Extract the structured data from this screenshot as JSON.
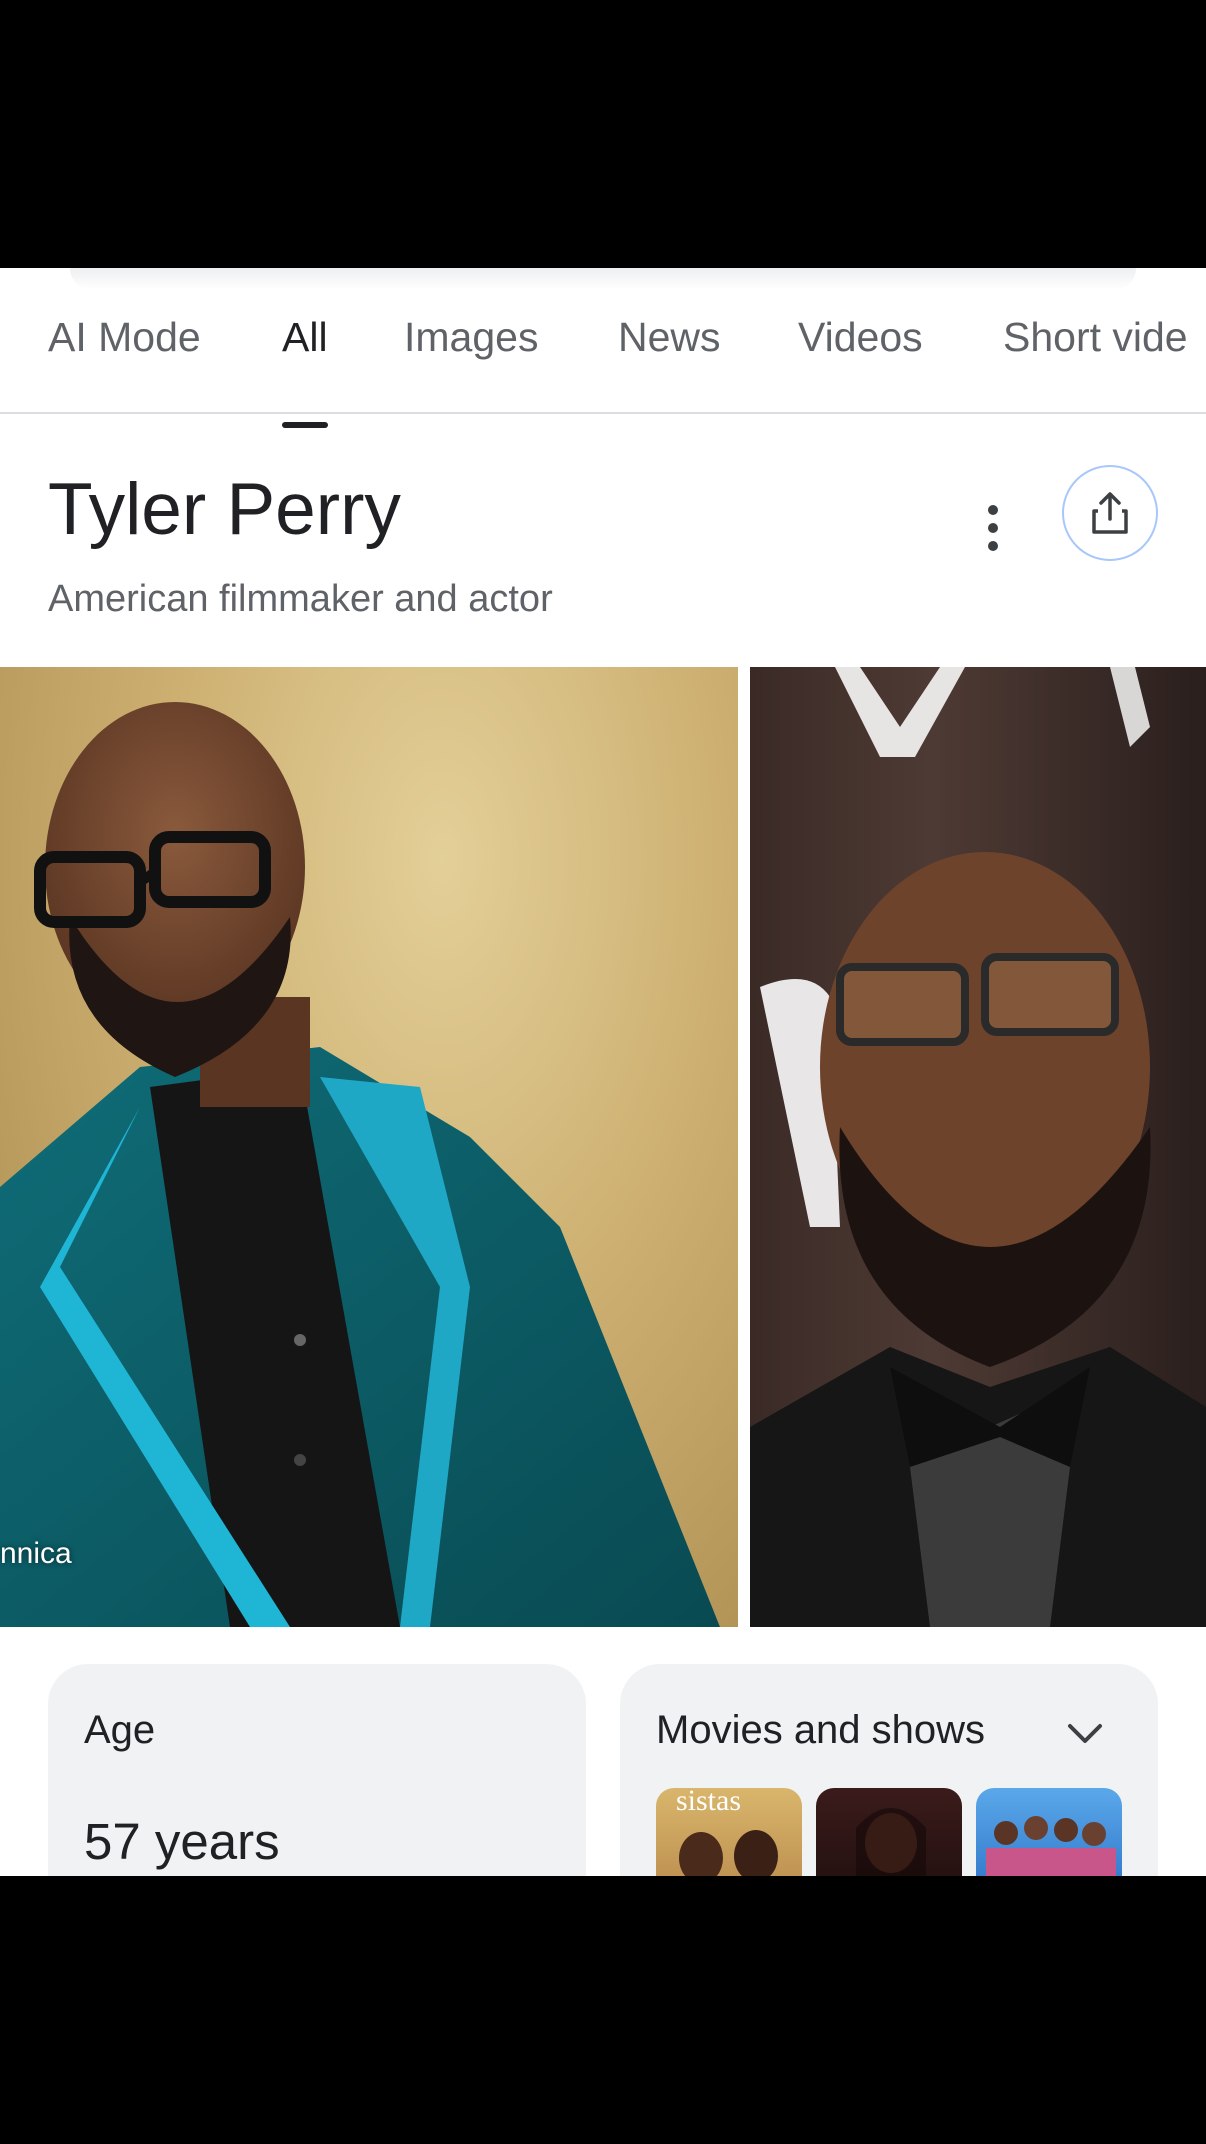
{
  "tabs": [
    {
      "label": "AI Mode",
      "active": false
    },
    {
      "label": "All",
      "active": true
    },
    {
      "label": "Images",
      "active": false
    },
    {
      "label": "News",
      "active": false
    },
    {
      "label": "Videos",
      "active": false
    },
    {
      "label": "Short vide",
      "active": false
    }
  ],
  "entity": {
    "title": "Tyler Perry",
    "subtitle": "American filmmaker and actor"
  },
  "images": {
    "credit": "nnica",
    "thumb_title_text": "sistas"
  },
  "cards": {
    "age": {
      "label": "Age",
      "value": "57 years"
    },
    "movies": {
      "label": "Movies and shows"
    }
  },
  "colors": {
    "accent_border": "#a8c7fa",
    "text_primary": "#202124",
    "text_secondary": "#5f6368",
    "card_bg": "#f0f2f3"
  },
  "icons": [
    "more-vert-icon",
    "share-icon",
    "chevron-down-icon"
  ]
}
